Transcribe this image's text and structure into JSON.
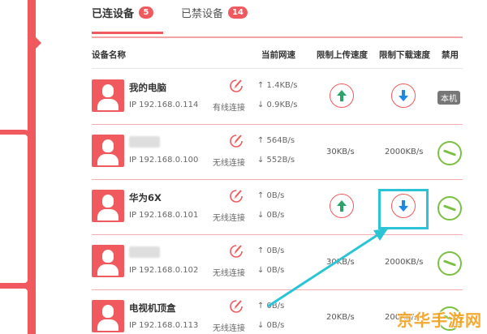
{
  "tabs": [
    {
      "label": "已连设备",
      "count": "5"
    },
    {
      "label": "已禁设备",
      "count": "14"
    }
  ],
  "table_headers": {
    "name": "设备名称",
    "current_speed": "当前网速",
    "limit_up": "限制上传速度",
    "limit_down": "限制下载速度",
    "ban": "禁用"
  },
  "devices": [
    {
      "name": "我的电脑",
      "name_blurred": false,
      "ip": "IP 192.168.0.114",
      "connection": "有线连接",
      "up": "↑ 1.4KB/s",
      "down": "↓ 0.9KB/s",
      "limit_up": "",
      "limit_down": "",
      "ban": "本机"
    },
    {
      "name": "",
      "name_blurred": true,
      "ip": "IP 192.168.0.100",
      "connection": "无线连接",
      "up": "↑ 564B/s",
      "down": "↓ 552B/s",
      "limit_up": "30KB/s",
      "limit_down": "2000KB/s",
      "ban": ""
    },
    {
      "name": "华为6X",
      "name_blurred": false,
      "ip": "IP 192.168.0.101",
      "connection": "无线连接",
      "up": "↑ 0B/s",
      "down": "↓ 0B/s",
      "limit_up": "",
      "limit_down": "",
      "ban": ""
    },
    {
      "name": "",
      "name_blurred": true,
      "ip": "IP 192.168.0.102",
      "connection": "无线连接",
      "up": "↑ 0B/s",
      "down": "↓ 0B/s",
      "limit_up": "30KB/s",
      "limit_down": "2000KB/s",
      "ban": ""
    },
    {
      "name": "电视机顶盒",
      "name_blurred": false,
      "ip": "IP 192.168.0.113",
      "connection": "无线连接",
      "up": "↑ 0B/s",
      "down": "↓ 0B/s",
      "limit_up": "20KB/s",
      "limit_down": "200KB/s",
      "ban": ""
    }
  ],
  "watermark": "京华手游网",
  "colors": {
    "accent": "#f0595d",
    "highlight": "#2bc4d6",
    "ban_green": "#7ac143",
    "arrow_blue": "#1e88e5",
    "arrow_green": "#2aa36b"
  }
}
